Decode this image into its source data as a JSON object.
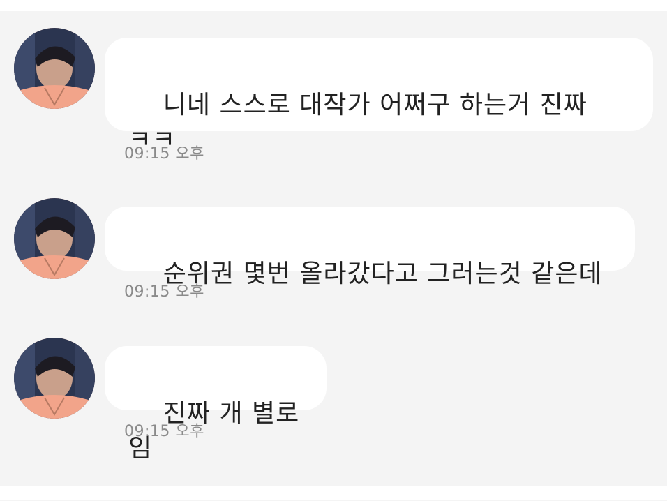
{
  "chat": {
    "messages": [
      {
        "text": "니네 스스로 대작가 어쩌구 하는거 진짜\nㅋㅋ",
        "time": "09:15 오후"
      },
      {
        "text": "순위권 몇번 올라갔다고 그러는것 같은데",
        "time": "09:15 오후"
      },
      {
        "text": "진짜 개 별로임",
        "time": "09:15 오후"
      }
    ]
  },
  "colors": {
    "background": "#f4f4f4",
    "bubble": "#ffffff",
    "text": "#222222",
    "time": "#8a8a8a",
    "avatar_shirt": "#f2a48a"
  }
}
